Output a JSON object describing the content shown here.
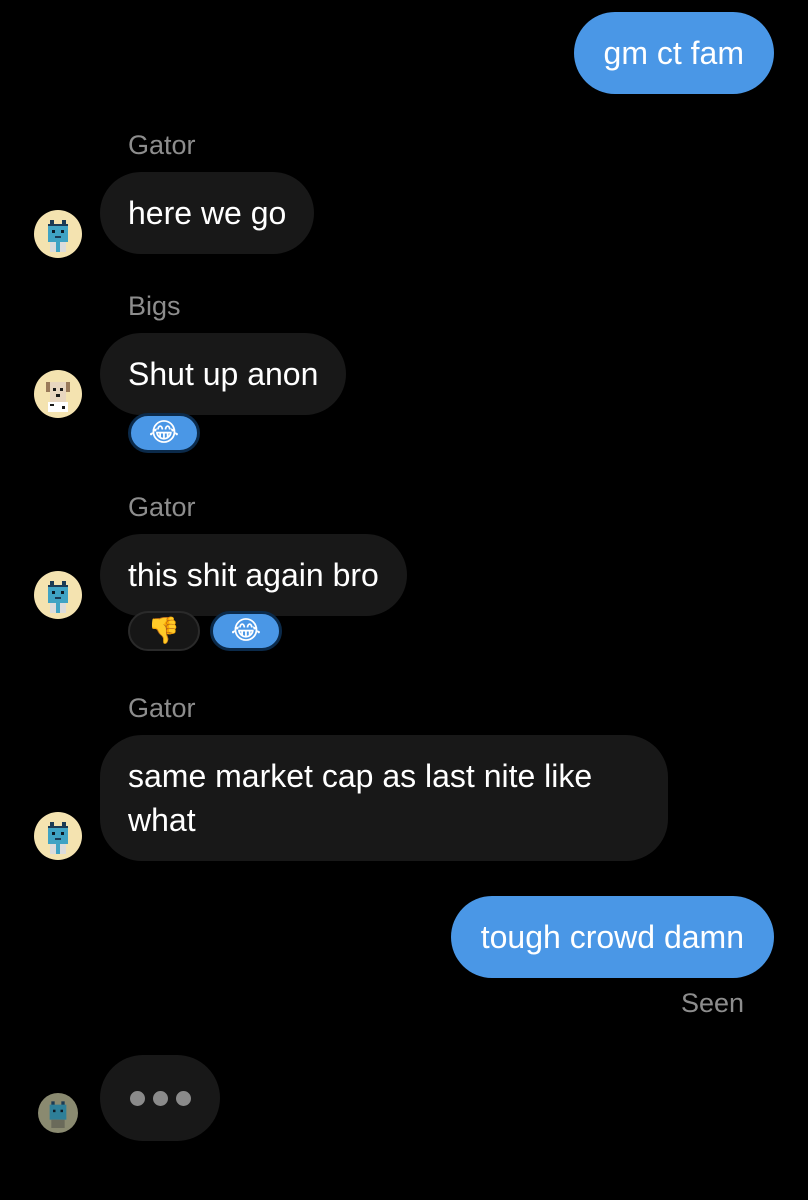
{
  "conversation": {
    "messages": [
      {
        "direction": "outgoing",
        "text": "gm ct fam"
      },
      {
        "direction": "incoming",
        "sender": "Gator",
        "text": "here we go"
      },
      {
        "direction": "incoming",
        "sender": "Bigs",
        "text": "Shut up anon",
        "reactions": [
          {
            "emoji": "😂",
            "mine": true
          }
        ]
      },
      {
        "direction": "incoming",
        "sender": "Gator",
        "text": "this shit again bro",
        "reactions": [
          {
            "emoji": "👎",
            "mine": false
          },
          {
            "emoji": "😂",
            "mine": true
          }
        ]
      },
      {
        "direction": "incoming",
        "sender": "Gator",
        "text": "same market cap as last nite like what"
      },
      {
        "direction": "outgoing",
        "text": "tough crowd damn",
        "status": "Seen"
      }
    ],
    "typing_indicator": {
      "visible": true
    }
  },
  "avatars": {
    "gator": {
      "icon": "pixel-cat-avatar-icon",
      "bg": "#f4e3b0",
      "face": "#3fa3c4"
    },
    "bigs": {
      "icon": "pixel-dog-avatar-icon",
      "bg": "#f4e3b0",
      "face": "#e8d6c0"
    },
    "typing": {
      "icon": "pixel-cat-avatar-icon",
      "bg": "#8a8a70",
      "face": "#2e7f98"
    }
  },
  "colors": {
    "outgoing_bubble": "#4a97e6",
    "incoming_bubble": "#181818",
    "background": "#000000",
    "meta_text": "#8d8d8d"
  }
}
